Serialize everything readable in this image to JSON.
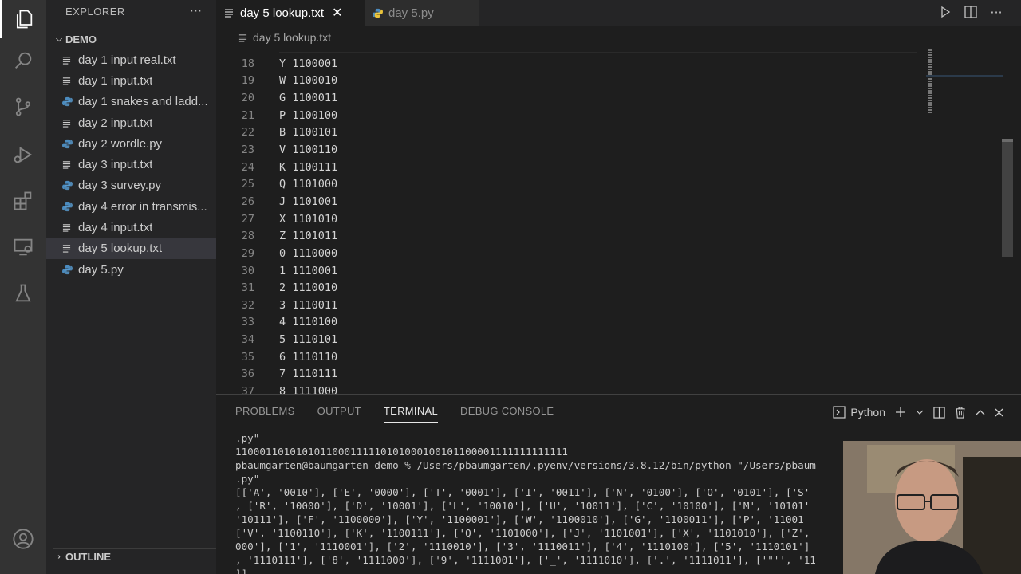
{
  "sidebar": {
    "title": "EXPLORER",
    "more": "···",
    "folder": "DEMO",
    "files": [
      {
        "name": "day 1 input real.txt",
        "type": "text"
      },
      {
        "name": "day 1 input.txt",
        "type": "text"
      },
      {
        "name": "day 1 snakes and ladd...",
        "type": "python"
      },
      {
        "name": "day 2 input.txt",
        "type": "text"
      },
      {
        "name": "day 2 wordle.py",
        "type": "python"
      },
      {
        "name": "day 3 input.txt",
        "type": "text"
      },
      {
        "name": "day 3 survey.py",
        "type": "python"
      },
      {
        "name": "day 4 error in transmis...",
        "type": "python"
      },
      {
        "name": "day 4 input.txt",
        "type": "text"
      },
      {
        "name": "day 5 lookup.txt",
        "type": "text",
        "selected": true
      },
      {
        "name": "day 5.py",
        "type": "python"
      }
    ],
    "outline": "OUTLINE"
  },
  "tabs": [
    {
      "label": "day 5 lookup.txt",
      "active": true
    },
    {
      "label": "day 5.py",
      "active": false
    }
  ],
  "breadcrumb": "day 5 lookup.txt",
  "editor": {
    "lines": [
      {
        "n": "18",
        "text": "Y 1100001"
      },
      {
        "n": "19",
        "text": "W 1100010"
      },
      {
        "n": "20",
        "text": "G 1100011"
      },
      {
        "n": "21",
        "text": "P 1100100"
      },
      {
        "n": "22",
        "text": "B 1100101"
      },
      {
        "n": "23",
        "text": "V 1100110"
      },
      {
        "n": "24",
        "text": "K 1100111"
      },
      {
        "n": "25",
        "text": "Q 1101000"
      },
      {
        "n": "26",
        "text": "J 1101001"
      },
      {
        "n": "27",
        "text": "X 1101010"
      },
      {
        "n": "28",
        "text": "Z 1101011"
      },
      {
        "n": "29",
        "text": "0 1110000"
      },
      {
        "n": "30",
        "text": "1 1110001"
      },
      {
        "n": "31",
        "text": "2 1110010"
      },
      {
        "n": "32",
        "text": "3 1110011"
      },
      {
        "n": "33",
        "text": "4 1110100"
      },
      {
        "n": "34",
        "text": "5 1110101"
      },
      {
        "n": "35",
        "text": "6 1110110"
      },
      {
        "n": "36",
        "text": "7 1110111"
      },
      {
        "n": "37",
        "text": "8 1111000"
      }
    ]
  },
  "panel": {
    "tabs": [
      "PROBLEMS",
      "OUTPUT",
      "TERMINAL",
      "DEBUG CONSOLE"
    ],
    "active_tab": "TERMINAL",
    "terminal_name": "Python",
    "terminal_lines": [
      ".py\"",
      "1100011010101011000111110101000100101100001111111111111",
      "pbaumgarten@baumgarten demo % /Users/pbaumgarten/.pyenv/versions/3.8.12/bin/python \"/Users/pbaum",
      ".py\"",
      "[['A', '0010'], ['E', '0000'], ['T', '0001'], ['I', '0011'], ['N', '0100'], ['O', '0101'], ['S'",
      ", ['R', '10000'], ['D', '10001'], ['L', '10010'], ['U', '10011'], ['C', '10100'], ['M', '10101'",
      "'10111'], ['F', '1100000'], ['Y', '1100001'], ['W', '1100010'], ['G', '1100011'], ['P', '11001",
      "['V', '1100110'], ['K', '1100111'], ['Q', '1101000'], ['J', '1101001'], ['X', '1101010'], ['Z',",
      "000'], ['1', '1110001'], ['2', '1110010'], ['3', '1110011'], ['4', '1110100'], ['5', '1110101']",
      ", '1110111'], ['8', '1111000'], ['9', '1111001'], ['_', '1111010'], ['.', '1111011'], ['\"'', '11",
      "]]"
    ]
  }
}
